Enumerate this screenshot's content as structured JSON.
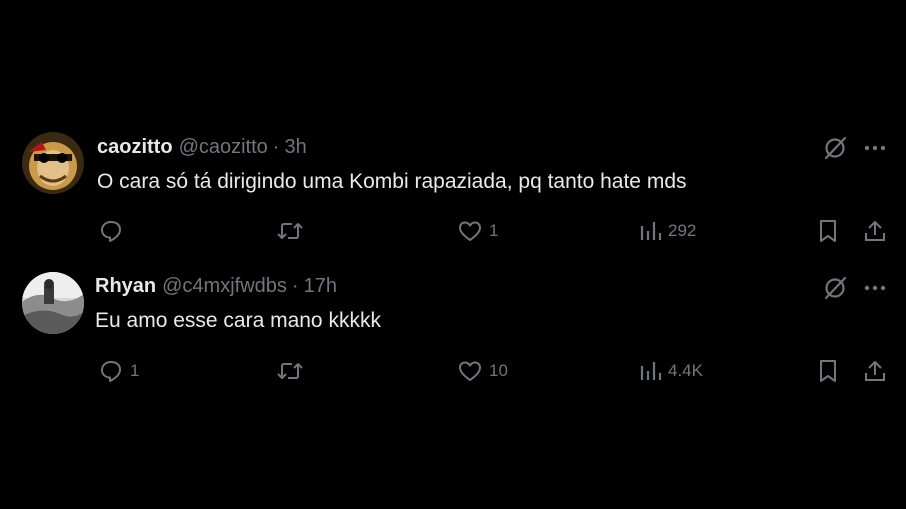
{
  "colors": {
    "background": "#000000",
    "primary_text": "#e7e9ea",
    "secondary_text": "#71767b"
  },
  "tweets": [
    {
      "display_name": "caozitto",
      "handle": "@caozitto",
      "separator": "·",
      "time": "3h",
      "text": "O cara só tá dirigindo uma Kombi rapaziada, pq tanto hate mds",
      "avatar_icon": "masked-character-avatar",
      "replies": "",
      "retweets": "",
      "likes": "1",
      "views": "292"
    },
    {
      "display_name": "Rhyan",
      "handle": "@c4mxjfwdbs",
      "separator": "·",
      "time": "17h",
      "text": "Eu amo esse cara mano kkkkk",
      "avatar_icon": "grayscale-photo-avatar",
      "replies": "1",
      "retweets": "",
      "likes": "10",
      "views": "4.4K"
    }
  ]
}
